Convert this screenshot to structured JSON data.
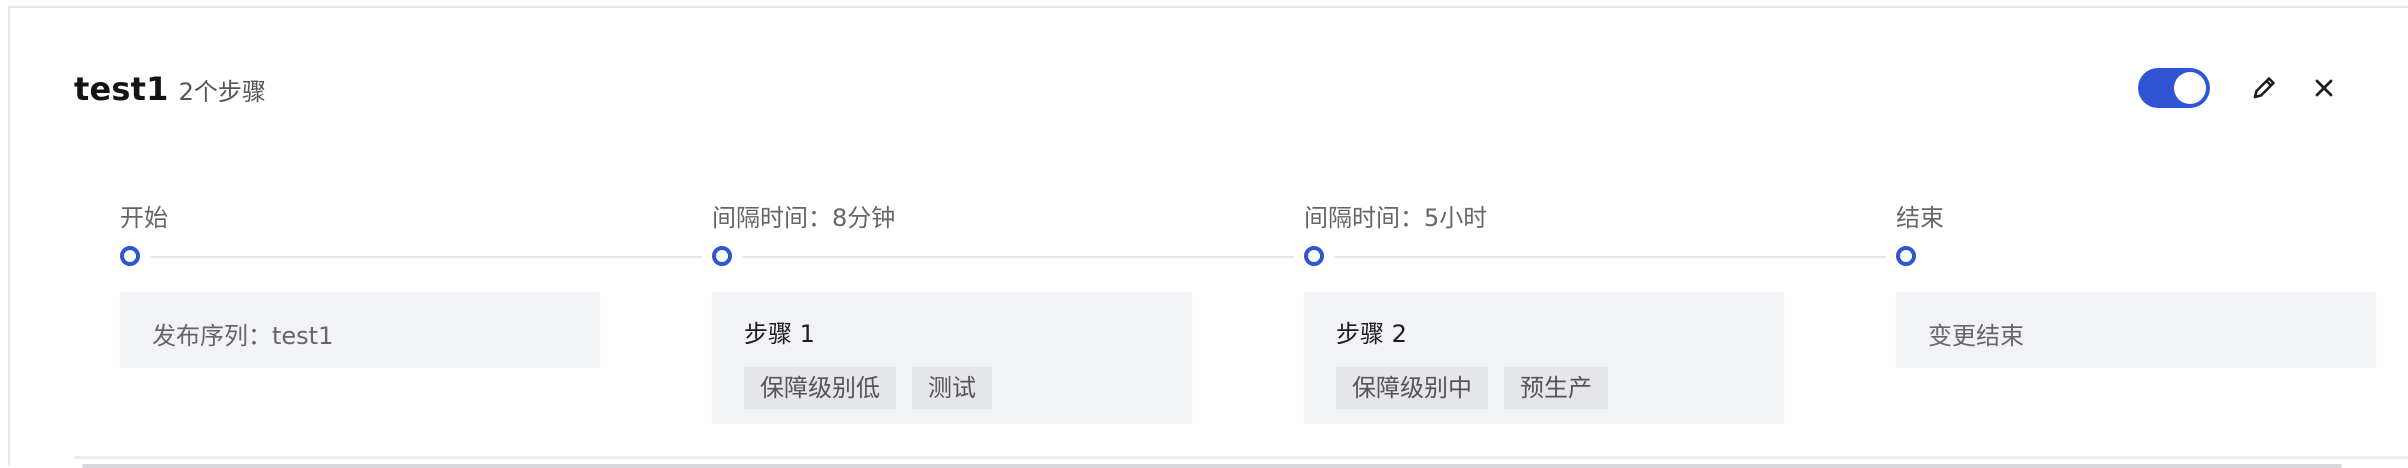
{
  "header": {
    "title": "test1",
    "subtitle": "2个步骤",
    "toggle_on": true,
    "accent_color": "#2f55d4",
    "icons": [
      "edit-icon",
      "close-icon"
    ]
  },
  "timeline": {
    "stages": [
      {
        "label": "开始",
        "box_text": "发布序列：test1"
      },
      {
        "label": "间隔时间：8分钟",
        "box_title": "步骤 1",
        "tags": [
          "保障级别低",
          "测试"
        ]
      },
      {
        "label": "间隔时间：5小时",
        "box_title": "步骤 2",
        "tags": [
          "保障级别中",
          "预生产"
        ]
      },
      {
        "label": "结束",
        "box_text": "变更结束"
      }
    ]
  }
}
